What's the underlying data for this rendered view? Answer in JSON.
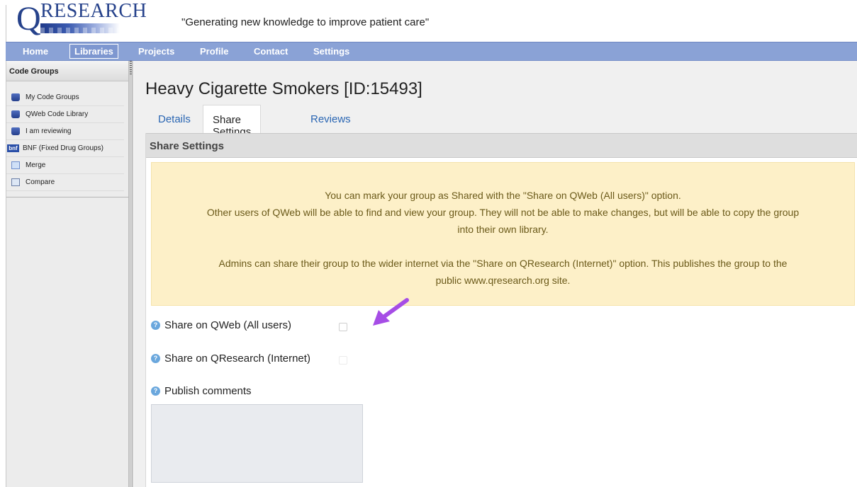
{
  "header": {
    "logo_letter": "Q",
    "logo_word": "RESEARCH",
    "tagline": "\"Generating new knowledge to improve patient care\""
  },
  "nav": {
    "items": [
      {
        "label": "Home"
      },
      {
        "label": "Libraries",
        "active": true
      },
      {
        "label": "Projects"
      },
      {
        "label": "Profile"
      },
      {
        "label": "Contact"
      },
      {
        "label": "Settings"
      }
    ]
  },
  "sidebar": {
    "title": "Code Groups",
    "items": [
      {
        "label": "My Code Groups",
        "icon": "database-icon"
      },
      {
        "label": "QWeb Code Library",
        "icon": "database-icon"
      },
      {
        "label": "I am reviewing",
        "icon": "database-icon"
      },
      {
        "label": "BNF (Fixed Drug Groups)",
        "icon": "bnf-icon",
        "icon_text": "bnf"
      },
      {
        "label": "Merge",
        "icon": "merge-icon"
      },
      {
        "label": "Compare",
        "icon": "compare-icon"
      }
    ]
  },
  "main": {
    "title": "Heavy Cigarette Smokers [ID:15493]",
    "tabs": [
      {
        "label": "Details"
      },
      {
        "label": "Share Settings",
        "active": true
      },
      {
        "label": "Reviews"
      }
    ],
    "panel_title": "Share Settings",
    "notice": {
      "line1": "You can mark your group as Shared with the \"Share on QWeb (All users)\" option.",
      "line2": "Other users of QWeb will be able to find and view your group. They will not be able to make changes, but will be able to copy the group",
      "line3": "into their own library.",
      "line4": "Admins can share their group to the wider internet via the \"Share on QResearch (Internet)\" option. This publishes the group to the",
      "line5": "public www.qresearch.org site."
    },
    "fields": {
      "share_qweb_label": "Share on QWeb (All users)",
      "share_qweb_checked": false,
      "share_qresearch_label": "Share on QResearch (Internet)",
      "share_qresearch_checked": false,
      "publish_comments_label": "Publish comments",
      "publish_comments_value": ""
    },
    "help_icon_glyph": "?"
  },
  "colors": {
    "brand_blue": "#26428b",
    "nav_bg": "#8aa2d6",
    "link": "#2a66b3",
    "notice_bg": "#fdf0c8",
    "notice_text": "#6b5a1a",
    "annotation_arrow": "#a64de6"
  }
}
